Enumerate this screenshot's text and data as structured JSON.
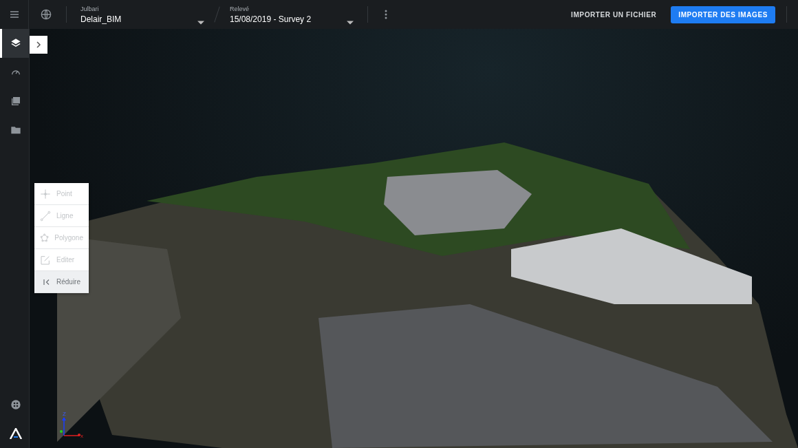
{
  "topbar": {
    "project": {
      "label": "Julbari",
      "value": "Delair_BIM"
    },
    "survey": {
      "label": "Relevé",
      "value": "15/08/2019 - Survey 2"
    },
    "actions": [
      {
        "label": "IMPORTER UN FICHIER",
        "kind": "text"
      },
      {
        "label": "IMPORTER DES IMAGES",
        "kind": "primary"
      }
    ]
  },
  "sidebar": {
    "items": [
      {
        "kind": "layers",
        "selected": true
      },
      {
        "kind": "gauge",
        "selected": false
      },
      {
        "kind": "images",
        "selected": false
      },
      {
        "kind": "folder",
        "selected": false
      }
    ]
  },
  "tools": [
    {
      "label": "Point",
      "kind": "point",
      "disabled": true
    },
    {
      "label": "Ligne",
      "kind": "line",
      "disabled": true
    },
    {
      "label": "Polygone",
      "kind": "polygon",
      "disabled": true
    },
    {
      "label": "Editer",
      "kind": "edit",
      "disabled": true
    },
    {
      "label": "Réduire",
      "kind": "collapse",
      "disabled": false
    }
  ],
  "axes": [
    {
      "label": "Z"
    },
    {
      "label": "x"
    }
  ]
}
